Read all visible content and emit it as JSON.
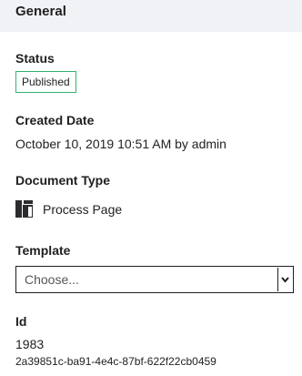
{
  "header": {
    "title": "General"
  },
  "status": {
    "label": "Status",
    "value": "Published",
    "badge_color": "#30b26e"
  },
  "created": {
    "label": "Created Date",
    "value": "October 10, 2019 10:51 AM by admin"
  },
  "document_type": {
    "label": "Document Type",
    "icon": "page-layout-icon",
    "value": "Process Page"
  },
  "template": {
    "label": "Template",
    "selected": "Choose..."
  },
  "id": {
    "label": "Id",
    "value": "1983",
    "uuid": "2a39851c-ba91-4e4c-87bf-622f22cb0459"
  }
}
